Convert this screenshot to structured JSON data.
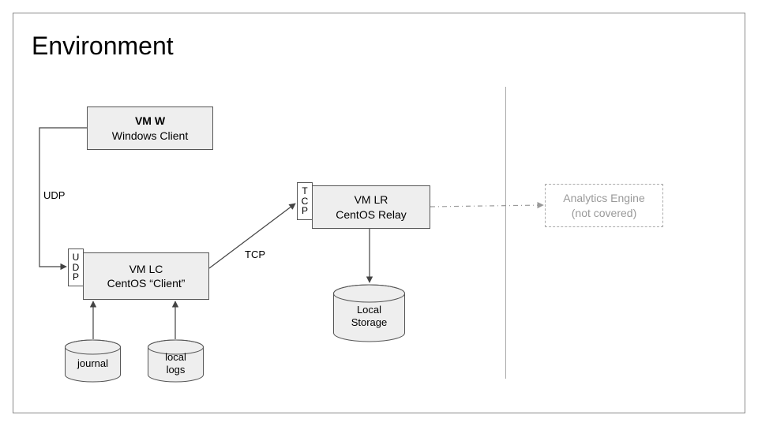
{
  "title": "Environment",
  "nodes": {
    "vmw": {
      "line1": "VM W",
      "line2": "Windows Client"
    },
    "vmlc": {
      "line1": "VM LC",
      "line2": "CentOS “Client”"
    },
    "vmlr": {
      "line1": "VM LR",
      "line2": "CentOS Relay"
    }
  },
  "tags": {
    "udp": "U\nD\nP",
    "tcp": "T\nC\nP"
  },
  "edge_labels": {
    "vmw_to_vmlc": "UDP",
    "vmlc_to_vmlr": "TCP"
  },
  "cylinders": {
    "journal": "journal",
    "local_logs": "local\nlogs",
    "local_storage": "Local\nStorage"
  },
  "ghost": {
    "analytics_l1": "Analytics Engine",
    "analytics_l2": "(not covered)"
  }
}
